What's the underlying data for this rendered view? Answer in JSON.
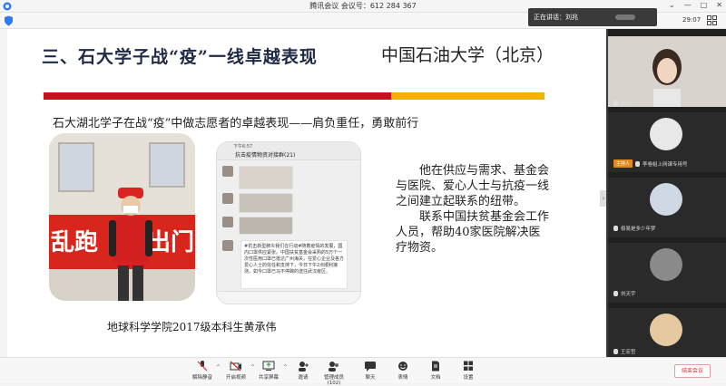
{
  "window": {
    "title": "腾讯会议 会议号：612 284 367"
  },
  "speaking": {
    "label": "正在讲话：刘兆",
    "timer": "29:07"
  },
  "slide": {
    "title": "三、石大学子战“疫”一线卓越表现",
    "university": "中国石油大学（北京）",
    "subtitle": "石大湖北学子在战“疫”中做志愿者的卓越表现——肩负重任，勇敢前行",
    "paragraph1": "他在供应与需求、基金会与医院、爱心人士与抗疫一线之间建立起联系的纽带。",
    "paragraph2": "联系中国扶贫基金会工作人员，帮助40家医院解决医疗物资。",
    "caption": "地球科学学院2017级本科生黄承伟",
    "photo_banner_left": "乱跑",
    "photo_banner_right": "出门",
    "chat_time": "下午6:57",
    "chat_group": "抗击疫情物资对接群(21)",
    "chat_message": "#抗击新型肺炎我们在行动#随着疫情的发展，国内口罩供应紧张。中国扶贫基金会采购的5万个一次性医用口罩已抵达广州海关，在爱心企业及各方爱心人士的信任和支持下，今日下午2点顺利接测，如今口罩已马不停蹄的送往武汉疫区。"
  },
  "participants": [
    {
      "name": "刘兆",
      "role": ""
    },
    {
      "name": "李卷姐上网课专用号",
      "role": "主持人"
    },
    {
      "name": "极易是多少年梦",
      "role": ""
    },
    {
      "name": "刘天宇",
      "role": ""
    },
    {
      "name": "王宏哲",
      "role": ""
    }
  ],
  "toolbar": {
    "mute": "解除静音",
    "video": "开启视频",
    "share": "共享屏幕",
    "invite": "邀请",
    "members": "管理成员(102)",
    "chat": "聊天",
    "reactions": "表情",
    "docs": "文档",
    "settings": "设置",
    "end": "结束会议"
  },
  "colors": {
    "accent_red": "#c8101e",
    "accent_yellow": "#f0b400",
    "host_tag": "#e08a1e"
  }
}
